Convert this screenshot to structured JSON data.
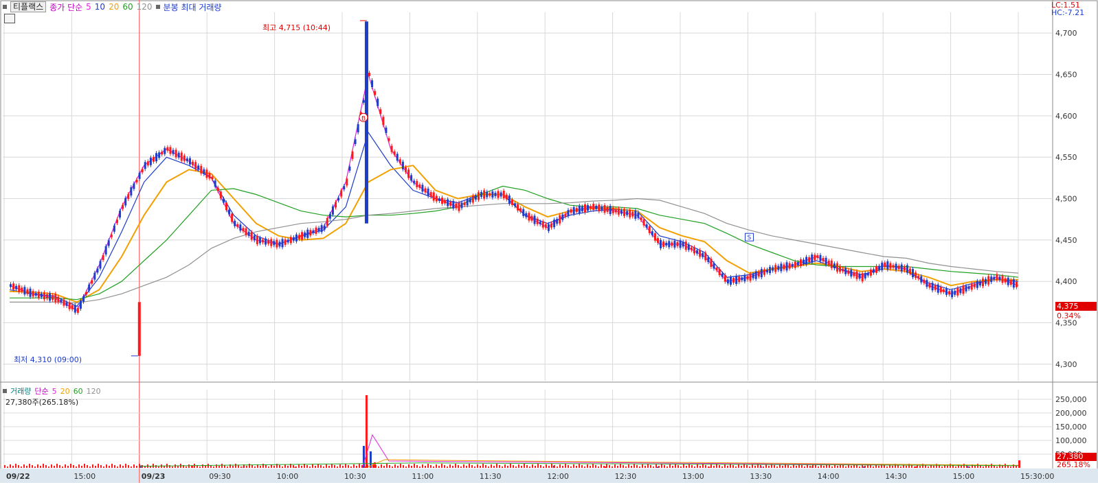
{
  "header": {
    "stock_name": "티플랙스",
    "ma_label": "종가 단순",
    "ma_periods": [
      "5",
      "10",
      "20",
      "60",
      "120"
    ],
    "extra": "분봉 최대 거래량",
    "lc": "LC:1.51",
    "hc": "HC:-7.21"
  },
  "volume_header": {
    "label": "거래량",
    "ma_label": "단순",
    "ma_periods": [
      "5",
      "20",
      "60",
      "120"
    ],
    "readout": "27,380주(265.18%)"
  },
  "annotations": {
    "high": "최고 4,715 (10:44)",
    "low": "최저 4,310 (09:00)",
    "buy_marker": "B",
    "sell_marker": "S"
  },
  "price_tag": {
    "price": "4,375",
    "change": "0.34%"
  },
  "volume_tag": {
    "volume": "27,380",
    "ratio": "265.18%"
  },
  "colors": {
    "up": "#ff1a1a",
    "down": "#1e3ec8",
    "ma5": "#e020e0",
    "ma10": "#1a3ad0",
    "ma20": "#f2a000",
    "ma60": "#20a020",
    "ma120": "#909090",
    "grid": "#d8d8d8",
    "axis_text": "#333333"
  },
  "chart_data": [
    {
      "type": "line",
      "title": "",
      "xlabel": "",
      "ylabel": "",
      "ylim": [
        4280,
        4725
      ],
      "x_ticks": [
        "09/22",
        "15:00",
        "09/23",
        "09:30",
        "10:00",
        "10:30",
        "11:00",
        "11:30",
        "12:00",
        "12:30",
        "13:00",
        "13:30",
        "14:00",
        "14:30",
        "15:00",
        "15:30:00"
      ],
      "y_ticks": [
        4300,
        4350,
        4400,
        4450,
        4500,
        4550,
        4600,
        4650,
        4700
      ],
      "y_tick_labels": [
        "4,300",
        "4,350",
        "4,400",
        "4,450",
        "4,500",
        "4,550",
        "4,600",
        "4,650",
        "4,700"
      ],
      "grid": true,
      "series": [
        {
          "name": "5",
          "role": "ma5",
          "x": [
            "prev",
            "prev",
            "prev",
            "09:00",
            "09:10",
            "09:20",
            "09:25",
            "09:30",
            "09:40",
            "09:50",
            "10:00",
            "10:10",
            "10:20",
            "10:30",
            "10:35",
            "10:40",
            "10:44",
            "10:48",
            "10:55",
            "11:00",
            "11:10",
            "11:20",
            "11:30",
            "11:40",
            "11:50",
            "12:00",
            "12:10",
            "12:20",
            "12:30",
            "12:40",
            "12:50",
            "13:00",
            "13:10",
            "13:20",
            "13:30",
            "13:40",
            "13:50",
            "14:00",
            "14:10",
            "14:20",
            "14:30",
            "14:40",
            "14:50",
            "15:00",
            "15:10",
            "15:20"
          ],
          "values": [
            4395,
            4385,
            4380,
            4365,
            4420,
            4490,
            4540,
            4560,
            4545,
            4525,
            4470,
            4450,
            4445,
            4455,
            4465,
            4520,
            4650,
            4560,
            4520,
            4500,
            4490,
            4505,
            4505,
            4480,
            4465,
            4485,
            4490,
            4485,
            4480,
            4445,
            4445,
            4430,
            4400,
            4405,
            4415,
            4420,
            4430,
            4415,
            4405,
            4420,
            4415,
            4395,
            4385,
            4395,
            4405,
            4395
          ]
        },
        {
          "name": "10",
          "role": "ma10",
          "x": [
            "prev",
            "prev",
            "prev",
            "09:00",
            "09:10",
            "09:20",
            "09:25",
            "09:30",
            "09:40",
            "09:50",
            "10:00",
            "10:10",
            "10:20",
            "10:30",
            "10:35",
            "10:40",
            "10:44",
            "10:48",
            "10:55",
            "11:00",
            "11:10",
            "11:20",
            "11:30",
            "11:40",
            "11:50",
            "12:00",
            "12:10",
            "12:20",
            "12:30",
            "12:40",
            "12:50",
            "13:00",
            "13:10",
            "13:20",
            "13:30",
            "13:40",
            "13:50",
            "14:00",
            "14:10",
            "14:20",
            "14:30",
            "14:40",
            "14:50",
            "15:00",
            "15:10",
            "15:20"
          ],
          "values": [
            4390,
            4385,
            4382,
            4370,
            4405,
            4460,
            4520,
            4550,
            4540,
            4525,
            4480,
            4455,
            4445,
            4455,
            4462,
            4490,
            4580,
            4540,
            4510,
            4500,
            4495,
            4505,
            4505,
            4480,
            4470,
            4480,
            4485,
            4487,
            4485,
            4455,
            4448,
            4435,
            4405,
            4408,
            4415,
            4418,
            4425,
            4415,
            4408,
            4415,
            4412,
            4398,
            4390,
            4398,
            4402,
            4400
          ]
        },
        {
          "name": "20",
          "role": "ma20",
          "x": [
            "prev",
            "prev",
            "prev",
            "09:00",
            "09:10",
            "09:20",
            "09:25",
            "09:30",
            "09:40",
            "09:50",
            "10:00",
            "10:10",
            "10:20",
            "10:30",
            "10:35",
            "10:40",
            "10:44",
            "10:48",
            "10:55",
            "11:00",
            "11:10",
            "11:20",
            "11:30",
            "11:40",
            "11:50",
            "12:00",
            "12:10",
            "12:20",
            "12:30",
            "12:40",
            "12:50",
            "13:00",
            "13:10",
            "13:20",
            "13:30",
            "13:40",
            "13:50",
            "14:00",
            "14:10",
            "14:20",
            "14:30",
            "14:40",
            "14:50",
            "15:00",
            "15:10",
            "15:20"
          ],
          "values": [
            4388,
            4387,
            4385,
            4375,
            4390,
            4430,
            4480,
            4520,
            4535,
            4530,
            4500,
            4470,
            4455,
            4450,
            4452,
            4470,
            4520,
            4535,
            4540,
            4510,
            4500,
            4505,
            4505,
            4490,
            4478,
            4485,
            4488,
            4488,
            4485,
            4465,
            4455,
            4448,
            4425,
            4410,
            4415,
            4418,
            4422,
            4418,
            4412,
            4415,
            4412,
            4405,
            4395,
            4400,
            4402,
            4402
          ]
        },
        {
          "name": "60",
          "role": "ma60",
          "x": [
            "prev",
            "prev",
            "prev",
            "09:00",
            "09:10",
            "09:20",
            "09:25",
            "09:30",
            "09:40",
            "09:50",
            "10:00",
            "10:10",
            "10:20",
            "10:30",
            "10:35",
            "10:40",
            "10:44",
            "10:48",
            "10:55",
            "11:00",
            "11:10",
            "11:20",
            "11:30",
            "11:40",
            "11:50",
            "12:00",
            "12:10",
            "12:20",
            "12:30",
            "12:40",
            "12:50",
            "13:00",
            "13:10",
            "13:20",
            "13:30",
            "13:40",
            "13:50",
            "14:00",
            "14:10",
            "14:20",
            "14:30",
            "14:40",
            "14:50",
            "15:00",
            "15:10",
            "15:20"
          ],
          "values": [
            4380,
            4380,
            4380,
            4378,
            4385,
            4400,
            4425,
            4450,
            4480,
            4510,
            4512,
            4505,
            4495,
            4485,
            4480,
            4478,
            4480,
            4480,
            4482,
            4485,
            4490,
            4505,
            4515,
            4510,
            4500,
            4492,
            4490,
            4490,
            4488,
            4480,
            4475,
            4470,
            4458,
            4445,
            4435,
            4425,
            4420,
            4418,
            4418,
            4418,
            4418,
            4415,
            4412,
            4410,
            4408,
            4405
          ]
        },
        {
          "name": "120",
          "role": "ma120",
          "x": [
            "prev",
            "prev",
            "prev",
            "09:00",
            "09:10",
            "09:20",
            "09:25",
            "09:30",
            "09:40",
            "09:50",
            "10:00",
            "10:10",
            "10:20",
            "10:30",
            "10:35",
            "10:40",
            "10:44",
            "10:48",
            "10:55",
            "11:00",
            "11:10",
            "11:20",
            "11:30",
            "11:40",
            "11:50",
            "12:00",
            "12:10",
            "12:20",
            "12:30",
            "12:40",
            "12:50",
            "13:00",
            "13:10",
            "13:20",
            "13:30",
            "13:40",
            "13:50",
            "14:00",
            "14:10",
            "14:20",
            "14:30",
            "14:40",
            "14:50",
            "15:00",
            "15:10",
            "15:20"
          ],
          "values": [
            4375,
            4375,
            4375,
            4374,
            4378,
            4385,
            4395,
            4405,
            4420,
            4440,
            4452,
            4460,
            4465,
            4470,
            4472,
            4475,
            4480,
            4482,
            4485,
            4488,
            4490,
            4492,
            4494,
            4494,
            4494,
            4495,
            4497,
            4498,
            4500,
            4498,
            4490,
            4482,
            4470,
            4462,
            4455,
            4450,
            4445,
            4440,
            4435,
            4430,
            4428,
            4422,
            4418,
            4415,
            4412,
            4410
          ]
        }
      ]
    },
    {
      "type": "bar",
      "title": "",
      "ylim": [
        0,
        285000
      ],
      "y_ticks": [
        50000,
        100000,
        150000,
        200000,
        250000
      ],
      "y_tick_labels": [
        "50,000",
        "100,000",
        "150,000",
        "200,000",
        "250,000"
      ],
      "grid": true,
      "categories": [
        "09:00",
        "09:30",
        "10:00",
        "10:30",
        "10:40",
        "10:44",
        "10:46",
        "10:50",
        "11:00",
        "11:30",
        "12:00",
        "12:30",
        "13:00",
        "13:30",
        "14:00",
        "14:30",
        "15:00",
        "15:20"
      ],
      "series": [
        {
          "name": "거래량",
          "values": [
            9000,
            7000,
            5000,
            4000,
            80000,
            265000,
            60000,
            20000,
            8000,
            5000,
            4000,
            4000,
            5000,
            6000,
            5000,
            5000,
            6000,
            27380
          ]
        }
      ]
    }
  ]
}
